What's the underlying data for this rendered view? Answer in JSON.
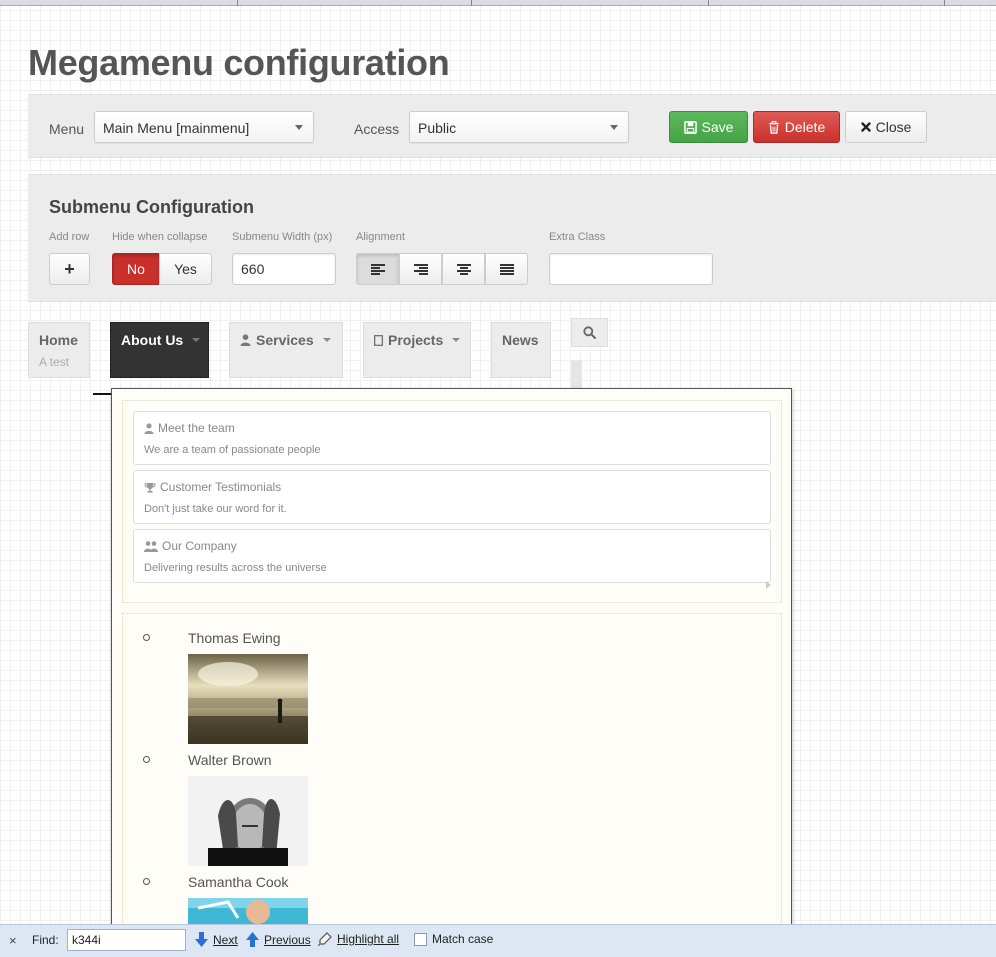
{
  "page": {
    "title": "Megamenu configuration"
  },
  "toolbar": {
    "menu_label": "Menu",
    "menu_value": "Main Menu [mainmenu]",
    "access_label": "Access",
    "access_value": "Public",
    "save_label": "Save",
    "delete_label": "Delete",
    "close_label": "Close"
  },
  "submenu": {
    "title": "Submenu Configuration",
    "add_row_label": "Add row",
    "add_row_button": "+",
    "hide_label": "Hide when collapse",
    "hide_no": "No",
    "hide_yes": "Yes",
    "width_label": "Submenu Width (px)",
    "width_value": "660",
    "alignment_label": "Alignment",
    "alignment_selected": "left",
    "extra_class_label": "Extra Class",
    "extra_class_value": ""
  },
  "menu_bar": {
    "items": [
      {
        "label": "Home",
        "subtitle": "A test"
      },
      {
        "label": "About Us"
      },
      {
        "label": "Services"
      },
      {
        "label": "Projects"
      },
      {
        "label": "News"
      }
    ]
  },
  "dropdown": {
    "links": [
      {
        "title": "Meet the team",
        "desc": "We are a team of passionate people",
        "icon": "user-icon"
      },
      {
        "title": "Customer Testimonials",
        "desc": "Don't just take our word for it.",
        "icon": "trophy-icon"
      },
      {
        "title": "Our Company",
        "desc": "Delivering results across the universe",
        "icon": "users-icon"
      }
    ],
    "people": [
      {
        "name": "Thomas Ewing"
      },
      {
        "name": "Walter Brown"
      },
      {
        "name": "Samantha Cook"
      }
    ]
  },
  "findbar": {
    "close": "×",
    "find_label": "Find:",
    "query": "k344i",
    "next": "Next",
    "previous": "Previous",
    "highlight_all": "Highlight all",
    "match_case": "Match case"
  },
  "colors": {
    "save": "#5cb85c",
    "delete": "#d9534f",
    "active_menu": "#333333",
    "no_toggle": "#c9302c"
  }
}
